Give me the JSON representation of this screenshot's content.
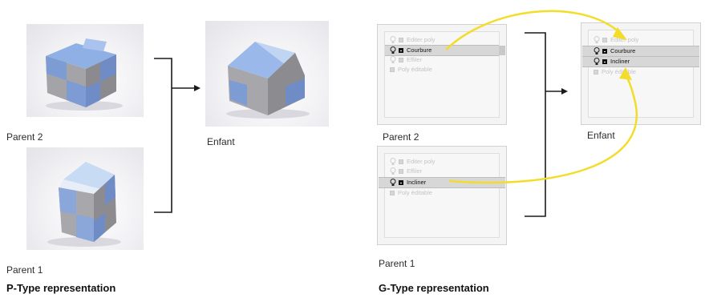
{
  "left_section": {
    "heading": "P-Type representation",
    "parent2_label": "Parent 2",
    "parent1_label": "Parent 1",
    "child_label": "Enfant"
  },
  "right_section": {
    "heading": "G-Type representation",
    "parent2_label": "Parent 2",
    "parent1_label": "Parent 1",
    "child_label": "Enfant",
    "parent2_stack": [
      {
        "label": "Editer poly",
        "selected": false,
        "bulb": true
      },
      {
        "label": "Courbure",
        "selected": true,
        "bulb": true
      },
      {
        "label": "Effiler",
        "selected": false,
        "bulb": true
      },
      {
        "label": "Poly éditable",
        "selected": false,
        "bulb": false
      }
    ],
    "parent1_stack": [
      {
        "label": "Editer poly",
        "selected": false,
        "bulb": true
      },
      {
        "label": "Effiler",
        "selected": false,
        "bulb": true
      },
      {
        "label": "Incliner",
        "selected": true,
        "bulb": true
      },
      {
        "label": "Poly éditable",
        "selected": false,
        "bulb": false
      }
    ],
    "child_stack": [
      {
        "label": "Editer poly",
        "selected": false,
        "bulb": true
      },
      {
        "label": "Courbure",
        "selected": true,
        "bulb": true
      },
      {
        "label": "Incliner",
        "selected": true,
        "bulb": true
      },
      {
        "label": "Poly éditable",
        "selected": false,
        "bulb": false
      }
    ]
  },
  "colors": {
    "blue_face": "#7f9ed6",
    "grey_face": "#a3a3a6",
    "roof_light": "#b8cff0",
    "arrow_yellow": "#f3dc2a",
    "bracket": "#1a1a1a"
  }
}
